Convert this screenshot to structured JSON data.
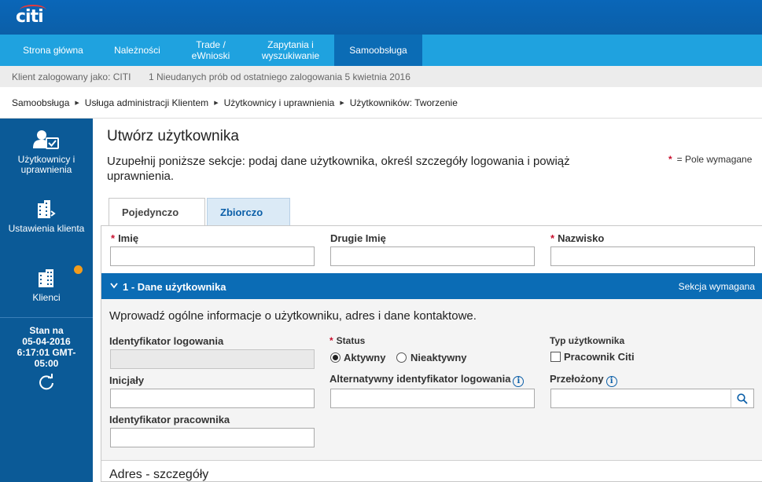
{
  "brand": {
    "logo_text": "citi"
  },
  "nav": {
    "items": [
      {
        "label": "Strona główna"
      },
      {
        "label": "Należności"
      },
      {
        "label": "Trade / eWnioski"
      },
      {
        "label": "Zapytania i wyszukiwanie"
      },
      {
        "label": "Samoobsługa",
        "active": true
      }
    ]
  },
  "info_bar": {
    "logged_label": "Klient zalogowany jako: CITI",
    "failed_login_message": "1 Nieudanych prób od ostatniego zalogowania 5 kwietnia 2016"
  },
  "breadcrumb": [
    "Samoobsługa",
    "Usługa administracji Klientem",
    "Użytkownicy i uprawnienia",
    "Użytkowników: Tworzenie"
  ],
  "sidebar": {
    "items": [
      {
        "label": "Użytkownicy i uprawnienia",
        "icon": "users-check-icon"
      },
      {
        "label": "Ustawienia klienta",
        "icon": "building-settings-icon"
      },
      {
        "label": "Klienci",
        "icon": "building-icon",
        "notification": true
      }
    ],
    "status": {
      "line1": "Stan na",
      "line2": "05-04-2016",
      "line3": "6:17:01 GMT-",
      "line4": "05:00"
    }
  },
  "page": {
    "title": "Utwórz użytkownika",
    "description": "Uzupełnij poniższe sekcje: podaj dane użytkownika, określ szczegóły logowania i powiąż uprawnienia.",
    "required_star": "*",
    "required_note": "= Pole wymagane",
    "tabs": [
      {
        "label": "Pojedynczo",
        "active": true
      },
      {
        "label": "Zbiorczo",
        "active": false
      }
    ]
  },
  "name_fields": {
    "first_name": {
      "label": "Imię",
      "required": true,
      "value": ""
    },
    "middle_name": {
      "label": "Drugie Imię",
      "required": false,
      "value": ""
    },
    "last_name": {
      "label": "Nazwisko",
      "required": true,
      "value": ""
    }
  },
  "section1": {
    "title": "1 - Dane użytkownika",
    "required_label": "Sekcja wymagana",
    "intro": "Wprowadź ogólne informacje o użytkowniku, adres i dane kontaktowe.",
    "login_id": {
      "label": "Identyfikator logowania",
      "value": ""
    },
    "initials": {
      "label": "Inicjały",
      "value": ""
    },
    "employee_id": {
      "label": "Identyfikator pracownika",
      "value": ""
    },
    "status": {
      "label": "Status",
      "options": [
        "Aktywny",
        "Nieaktywny"
      ],
      "selected": "Aktywny"
    },
    "alt_login_id": {
      "label": "Alternatywny identyfikator logowania",
      "value": ""
    },
    "user_type": {
      "label": "Typ użytkownika",
      "checkbox_label": "Pracownik Citi",
      "checked": false
    },
    "supervisor": {
      "label": "Przełożony",
      "value": ""
    }
  },
  "address_section": {
    "title": "Adres - szczegóły"
  },
  "colors": {
    "header_blue": "#0b5fa8",
    "nav_blue": "#1fa2df",
    "sidebar_blue": "#0b5a97",
    "section_blue": "#0b6cb5",
    "required_red": "#c8102e",
    "notification_orange": "#f39c1c"
  }
}
